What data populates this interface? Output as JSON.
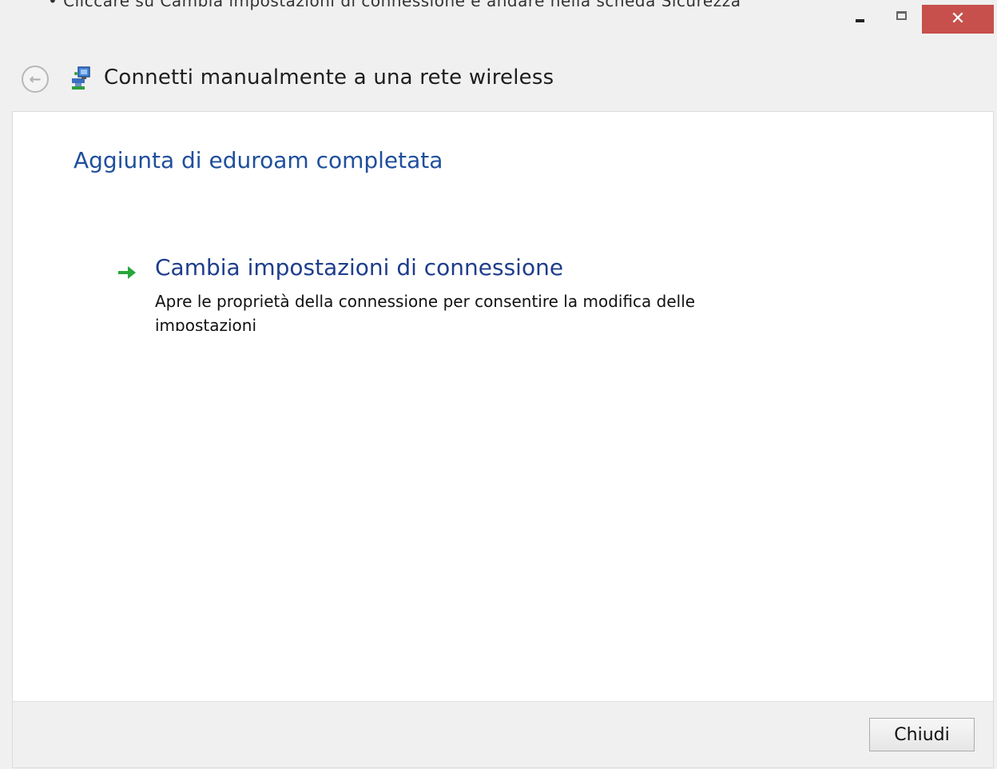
{
  "top_cut_text": "• Cliccare su Cambia impostazioni di connessione e andare nella scheda Sicurezza",
  "window": {
    "title": "Connetti manualmente a una rete wireless",
    "min_icon": "minimize-icon",
    "max_icon": "maximize-icon",
    "close_icon": "close-icon",
    "close_glyph": "✕",
    "close_color": "#c7504c"
  },
  "header": {
    "back_glyph": "←",
    "network_icon": "network-icon"
  },
  "main": {
    "heading": "Aggiunta di eduroam completata",
    "heading_color": "#1f4f9c",
    "link": {
      "title": "Cambia impostazioni di connessione",
      "description": "Apre le proprietà della connessione per consentire la modifica delle impostazioni",
      "icon": "green-arrow-icon"
    }
  },
  "footer": {
    "close_label": "Chiudi"
  }
}
